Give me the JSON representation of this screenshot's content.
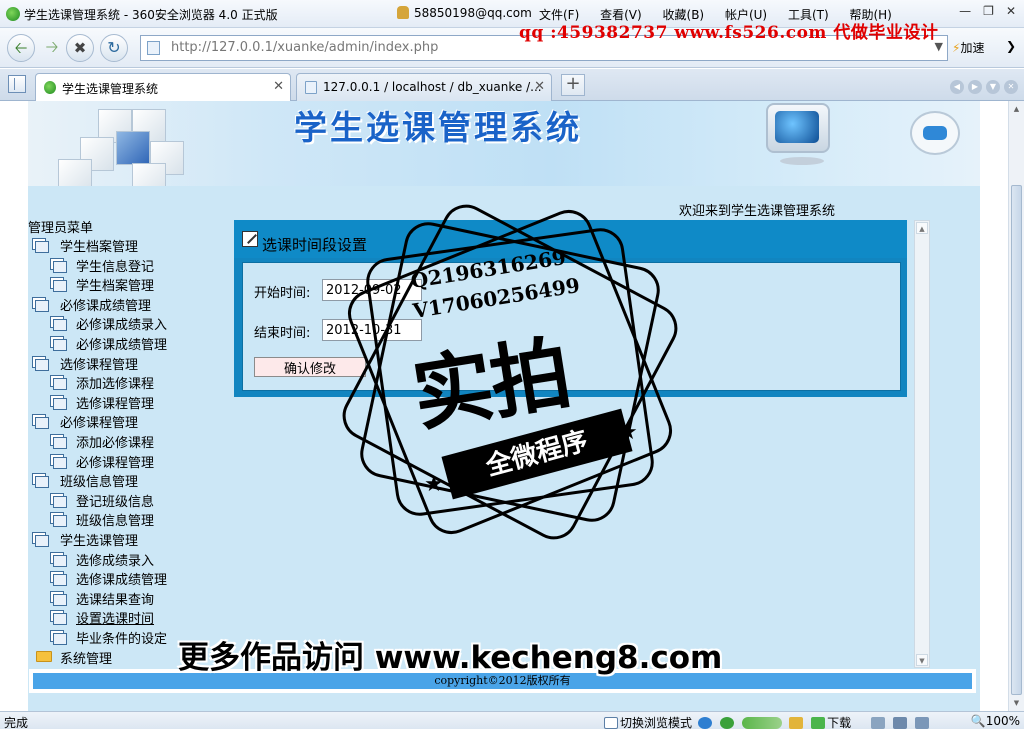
{
  "browser": {
    "window_title": "学生选课管理系统 - 360安全浏览器 4.0 正式版",
    "account_email": "58850198@qq.com",
    "menus": [
      "文件(F)",
      "查看(V)",
      "收藏(B)",
      "帐户(U)",
      "工具(T)",
      "帮助(H)"
    ],
    "url": "http://127.0.0.1/xuanke/admin/index.php",
    "speedup_label": "加速",
    "tabs": [
      {
        "title": "学生选课管理系统",
        "active": true
      },
      {
        "title": "127.0.0.1 / localhost / db_xuanke /...",
        "active": false
      }
    ],
    "status_text": "完成",
    "browse_mode_label": "切换浏览模式",
    "download_label": "下载",
    "zoom_level": "100%"
  },
  "watermarks": {
    "contact_line": "qq :459382737 www.fs526.com 代做毕业设计",
    "stamp_phone1": "Q2196316269",
    "stamp_phone2": "V17060256499",
    "stamp_big": "实拍",
    "stamp_ribbon": "全微程序",
    "more_works": "更多作品访问 www.kecheng8.com"
  },
  "page": {
    "banner_title": "学生选课管理系统",
    "welcome_text": "欢迎来到学生选课管理系统",
    "menu_title": "管理员菜单",
    "menu": [
      {
        "label": "学生档案管理",
        "type": "group"
      },
      {
        "label": "学生信息登记",
        "type": "item"
      },
      {
        "label": "学生档案管理",
        "type": "item"
      },
      {
        "label": "必修课成绩管理",
        "type": "group"
      },
      {
        "label": "必修课成绩录入",
        "type": "item"
      },
      {
        "label": "必修课成绩管理",
        "type": "item"
      },
      {
        "label": "选修课程管理",
        "type": "group"
      },
      {
        "label": "添加选修课程",
        "type": "item"
      },
      {
        "label": "选修课程管理",
        "type": "item"
      },
      {
        "label": "必修课程管理",
        "type": "group"
      },
      {
        "label": "添加必修课程",
        "type": "item"
      },
      {
        "label": "必修课程管理",
        "type": "item"
      },
      {
        "label": "班级信息管理",
        "type": "group"
      },
      {
        "label": "登记班级信息",
        "type": "item"
      },
      {
        "label": "班级信息管理",
        "type": "item"
      },
      {
        "label": "学生选课管理",
        "type": "group"
      },
      {
        "label": "选修成绩录入",
        "type": "item"
      },
      {
        "label": "选修课成绩管理",
        "type": "item"
      },
      {
        "label": "选课结果查询",
        "type": "item"
      },
      {
        "label": "设置选课时间",
        "type": "item",
        "current": true
      },
      {
        "label": "毕业条件的设定",
        "type": "item"
      },
      {
        "label": "系统管理",
        "type": "folder"
      }
    ],
    "panel": {
      "title": "选课时间段设置",
      "start_label": "开始时间:",
      "start_value": "2012-09-02",
      "end_label": "结束时间:",
      "end_value": "2012-10-31",
      "submit_label": "确认修改"
    },
    "copyright": "copyright©2012版权所有"
  }
}
